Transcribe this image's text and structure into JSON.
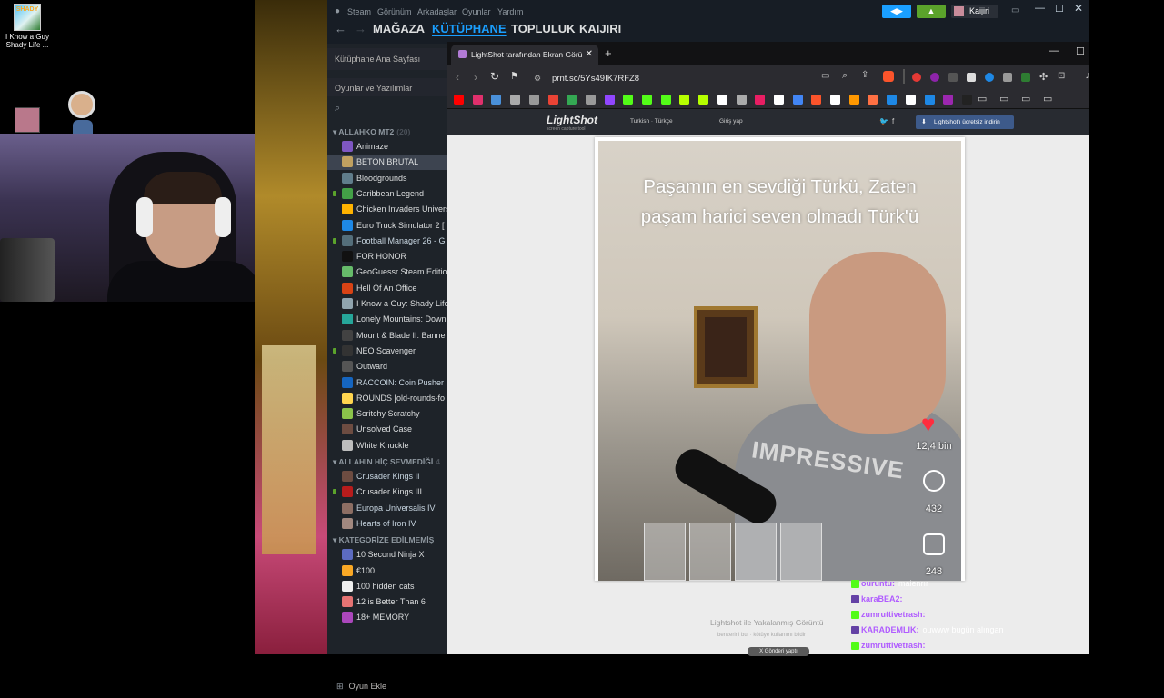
{
  "desktop": {
    "icon_label": "I Know a Guy Shady Life ...",
    "icon_text": "SHADY"
  },
  "steam": {
    "menu": [
      "Steam",
      "Görünüm",
      "Arkadaşlar",
      "Oyunlar",
      "Yardım"
    ],
    "nav": [
      "MAĞAZA",
      "KÜTÜPHANE",
      "TOPLULUK",
      "KAIJIRI"
    ],
    "user": "Kaijiri",
    "sidebar": {
      "home": "Kütüphane Ana Sayfası",
      "filter": "Oyunlar ve Yazılımlar",
      "categories": [
        {
          "label": "ALLAHKO MT2",
          "count": "(20)"
        },
        {
          "label": "ALLAHIN HİÇ SEVMEDİĞİ",
          "count": "4"
        },
        {
          "label": "KATEGORİZE EDİLMEMİŞ",
          "count": ""
        }
      ],
      "games": [
        "Animaze",
        "BETON BRUTAL",
        "Bloodgrounds",
        "Caribbean Legend",
        "Chicken Invaders Univers",
        "Euro Truck Simulator 2 [",
        "Football Manager 26 - G",
        "FOR HONOR",
        "GeoGuessr Steam Edition",
        "Hell Of An Office",
        "I Know a Guy: Shady Life",
        "Lonely Mountains: Down",
        "Mount & Blade II: Banne",
        "NEO Scavenger",
        "Outward",
        "RACCOIN: Coin Pusher R",
        "ROUNDS [old-rounds-fo",
        "Scritchy Scratchy",
        "Unsolved Case",
        "White Knuckle"
      ],
      "games2": [
        "Crusader Kings II",
        "Crusader Kings III",
        "Europa Universalis IV",
        "Hearts of Iron IV"
      ],
      "games3": [
        "10 Second Ninja X",
        "€100",
        "100 hidden cats",
        "12 is Better Than 6",
        "18+ MEMORY"
      ],
      "add_game": "Oyun Ekle"
    }
  },
  "browser": {
    "tab_title": "LightShot tarafından Ekran Görü",
    "url": "prnt.sc/5Ys49IK7RFZ8"
  },
  "lightshot": {
    "logo": "LightShot",
    "logo_sub": "screen capture tool",
    "lang": "Turkish · Türkçe",
    "login": "Giriş yap",
    "download": "Lightshot'ı ücretsiz indirin",
    "caption_line1": "Paşamın en sevdiği Türkü, Zaten",
    "caption_line2": "paşam harici seven olmadı Türk'ü",
    "likes": "12,4 bin",
    "comments": "432",
    "saves": "248",
    "tshirt": "IMPRESSIVE",
    "footer_title": "Lightshot ile Yakalanmış Görüntü",
    "footer_links": "benzerini bul  ·  kötüye kullanımı bildir",
    "footer_btn": "X Gönderi yaptı"
  },
  "chat": [
    {
      "user": "ouruntu:",
      "msg": "maienrır"
    },
    {
      "user": "karaBEA2:",
      "msg": ""
    },
    {
      "user": "zumruttivetrash:",
      "msg": ""
    },
    {
      "user": "KARADEMLIK:",
      "msg": "ouwww bugün alıngan"
    },
    {
      "user": "zumruttivetrash:",
      "msg": ""
    }
  ],
  "colors": {
    "steam_bg": "#171d25",
    "steam_accent": "#1a9fff",
    "close_red": "#e81123",
    "heart": "#ff2d3e"
  }
}
